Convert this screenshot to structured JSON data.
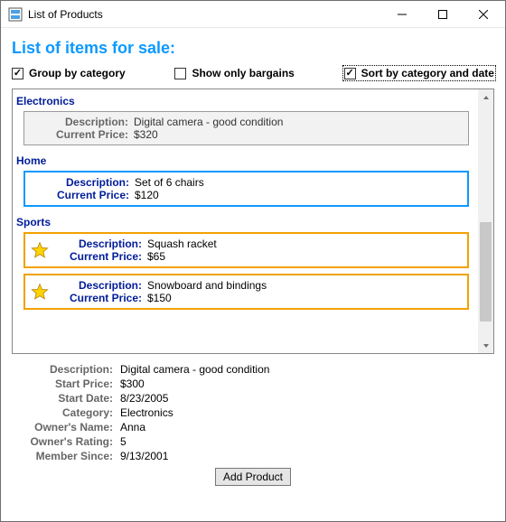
{
  "window": {
    "title": "List of Products"
  },
  "heading": "List of items for sale:",
  "checks": {
    "group": {
      "label": "Group by category",
      "checked": true
    },
    "bargains": {
      "label": "Show only bargains",
      "checked": false
    },
    "sort": {
      "label": "Sort by category and date",
      "checked": true
    }
  },
  "field_labels": {
    "description": "Description:",
    "current_price": "Current Price:"
  },
  "groups": [
    {
      "name": "Electronics",
      "items": [
        {
          "style": "gray",
          "star": false,
          "description": "Digital camera - good condition",
          "price": "$320"
        }
      ]
    },
    {
      "name": "Home",
      "items": [
        {
          "style": "blue",
          "star": false,
          "description": "Set of 6 chairs",
          "price": "$120"
        }
      ]
    },
    {
      "name": "Sports",
      "items": [
        {
          "style": "orange",
          "star": true,
          "description": "Squash racket",
          "price": "$65"
        },
        {
          "style": "orange",
          "star": true,
          "description": "Snowboard and bindings",
          "price": "$150"
        }
      ]
    }
  ],
  "details": {
    "labels": {
      "description": "Description:",
      "start_price": "Start Price:",
      "start_date": "Start Date:",
      "category": "Category:",
      "owners_name": "Owner's Name:",
      "owners_rating": "Owner's Rating:",
      "member_since": "Member Since:"
    },
    "values": {
      "description": "Digital camera - good condition",
      "start_price": "$300",
      "start_date": "8/23/2005",
      "category": "Electronics",
      "owners_name": "Anna",
      "owners_rating": "5",
      "member_since": "9/13/2001"
    }
  },
  "buttons": {
    "add_product": "Add Product"
  }
}
